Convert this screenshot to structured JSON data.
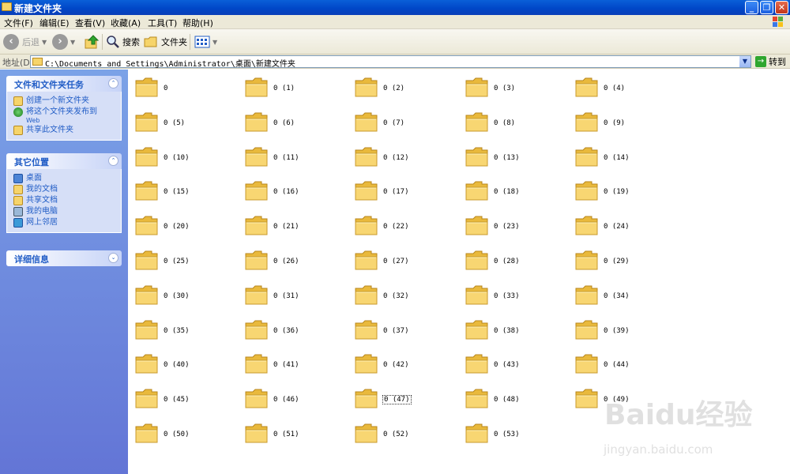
{
  "window": {
    "title": "新建文件夹"
  },
  "menu": [
    "文件(F)",
    "编辑(E)",
    "查看(V)",
    "收藏(A)",
    "工具(T)",
    "帮助(H)"
  ],
  "toolbar": {
    "back": "后退",
    "search": "搜索",
    "folders": "文件夹"
  },
  "address": {
    "label": "地址(D)",
    "value": "C:\\Documents and Settings\\Administrator\\桌面\\新建文件夹",
    "go": "转到"
  },
  "taskpane": {
    "file_tasks": {
      "title": "文件和文件夹任务",
      "items": [
        {
          "label": "创建一个新文件夹"
        },
        {
          "label": "将这个文件夹发布到",
          "sub": "Web"
        },
        {
          "label": "共享此文件夹"
        }
      ]
    },
    "other_places": {
      "title": "其它位置",
      "items": [
        {
          "label": "桌面"
        },
        {
          "label": "我的文档"
        },
        {
          "label": "共享文档"
        },
        {
          "label": "我的电脑"
        },
        {
          "label": "网上邻居"
        }
      ]
    },
    "details": {
      "title": "详细信息"
    }
  },
  "folders": [
    "0",
    "0 (1)",
    "0 (2)",
    "0 (3)",
    "0 (4)",
    "0 (5)",
    "0 (6)",
    "0 (7)",
    "0 (8)",
    "0 (9)",
    "0 (10)",
    "0 (11)",
    "0 (12)",
    "0 (13)",
    "0 (14)",
    "0 (15)",
    "0 (16)",
    "0 (17)",
    "0 (18)",
    "0 (19)",
    "0 (20)",
    "0 (21)",
    "0 (22)",
    "0 (23)",
    "0 (24)",
    "0 (25)",
    "0 (26)",
    "0 (27)",
    "0 (28)",
    "0 (29)",
    "0 (30)",
    "0 (31)",
    "0 (32)",
    "0 (33)",
    "0 (34)",
    "0 (35)",
    "0 (36)",
    "0 (37)",
    "0 (38)",
    "0 (39)",
    "0 (40)",
    "0 (41)",
    "0 (42)",
    "0 (43)",
    "0 (44)",
    "0 (45)",
    "0 (46)",
    "0 (47)",
    "0 (48)",
    "0 (49)",
    "0 (50)",
    "0 (51)",
    "0 (52)",
    "0 (53)"
  ],
  "focused_folder": "0 (47)",
  "watermark": {
    "logo": "Baidu经验",
    "url": "jingyan.baidu.com"
  },
  "colors": {
    "titlebar": "#0a5fd8",
    "taskpane": "#7ba2e7",
    "folder": "#f6d46a",
    "link": "#215dc6"
  }
}
